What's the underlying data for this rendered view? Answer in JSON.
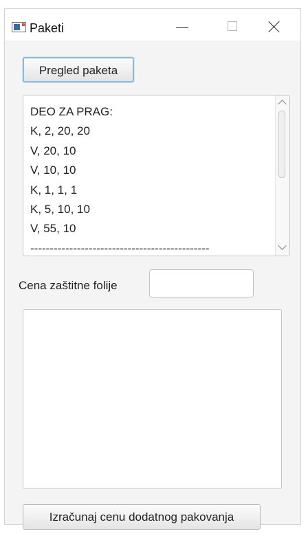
{
  "window": {
    "title": "Paketi"
  },
  "toolbar": {
    "review_label": "Pregled paketa"
  },
  "package_list": {
    "lines": [
      "DEO ZA PRAG:",
      "K, 2, 20, 20",
      "V, 20, 10",
      "V, 10, 10",
      "K, 1, 1, 1",
      "K, 5, 10, 10",
      "V, 55, 10",
      "----------------------------------------------"
    ]
  },
  "price_field": {
    "label": "Cena zaštitne folije",
    "value": ""
  },
  "output_area": {
    "value": ""
  },
  "footer": {
    "calc_label": "Izračunaj cenu dodatnog pakovanja"
  },
  "colors": {
    "focus_border": "#8fb6dc",
    "window_bg": "#f4f4f4"
  }
}
